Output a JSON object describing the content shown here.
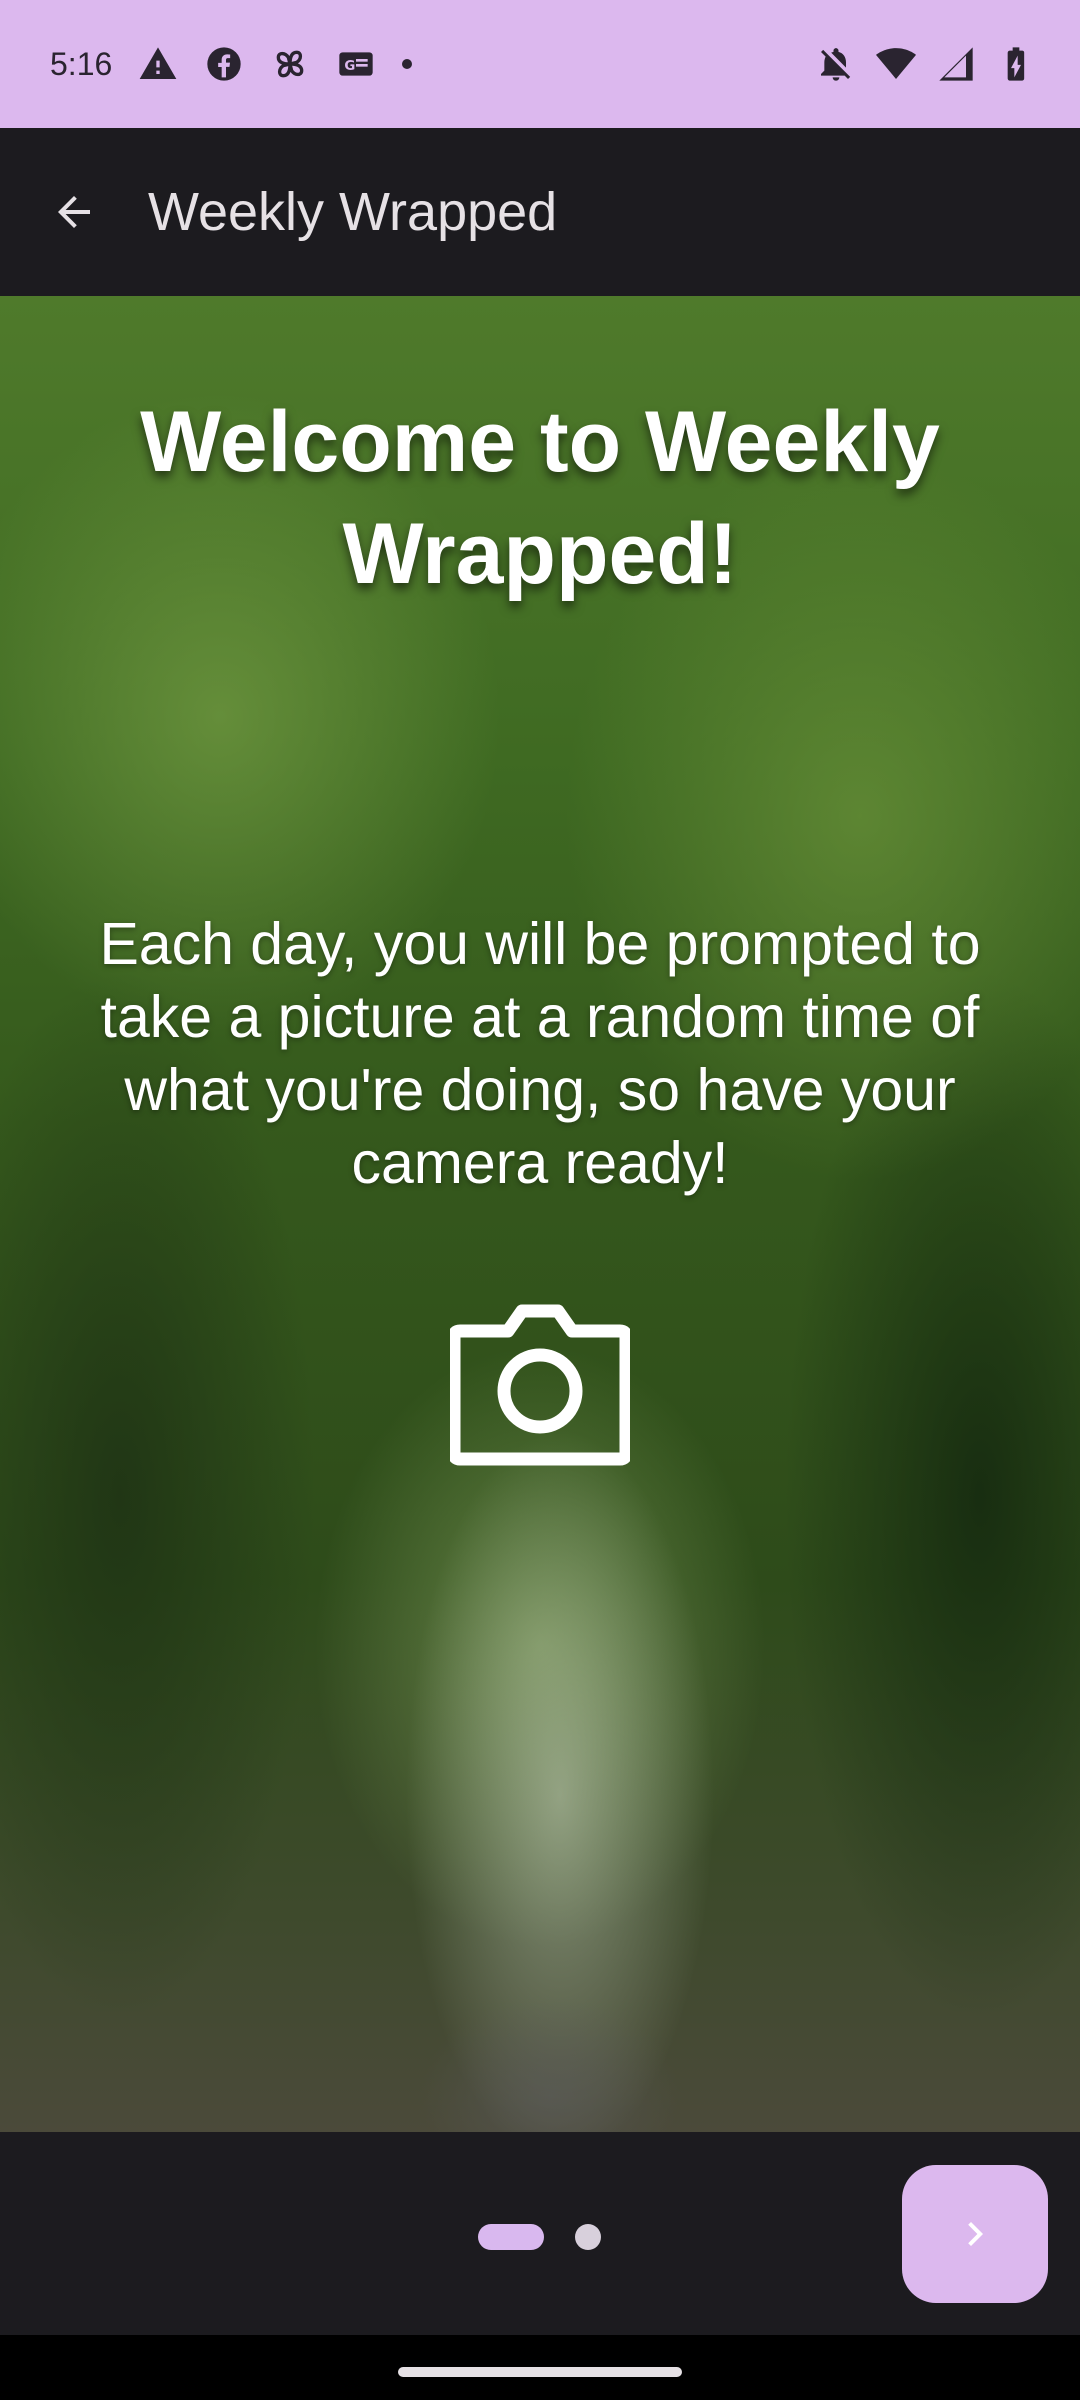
{
  "status_bar": {
    "time": "5:16",
    "left_icons": [
      "warning-icon",
      "facebook-icon",
      "pinwheel-icon",
      "news-icon",
      "dot-icon"
    ],
    "right_icons": [
      "notifications-off-icon",
      "wifi-icon",
      "signal-icon",
      "battery-charging-icon"
    ],
    "background_color": "#dcb8ee"
  },
  "app_bar": {
    "back_icon": "arrow-back-icon",
    "title": "Weekly Wrapped"
  },
  "onboarding": {
    "title": "Welcome to Weekly Wrapped!",
    "description": "Each day, you will be prompted to take a picture at a random time of what you're doing, so have your camera ready!",
    "icon": "camera-icon",
    "page_count": 2,
    "current_page": 1
  },
  "bottom_bar": {
    "next_icon": "chevron-right-icon",
    "accent_color": "#d9b8ef"
  }
}
